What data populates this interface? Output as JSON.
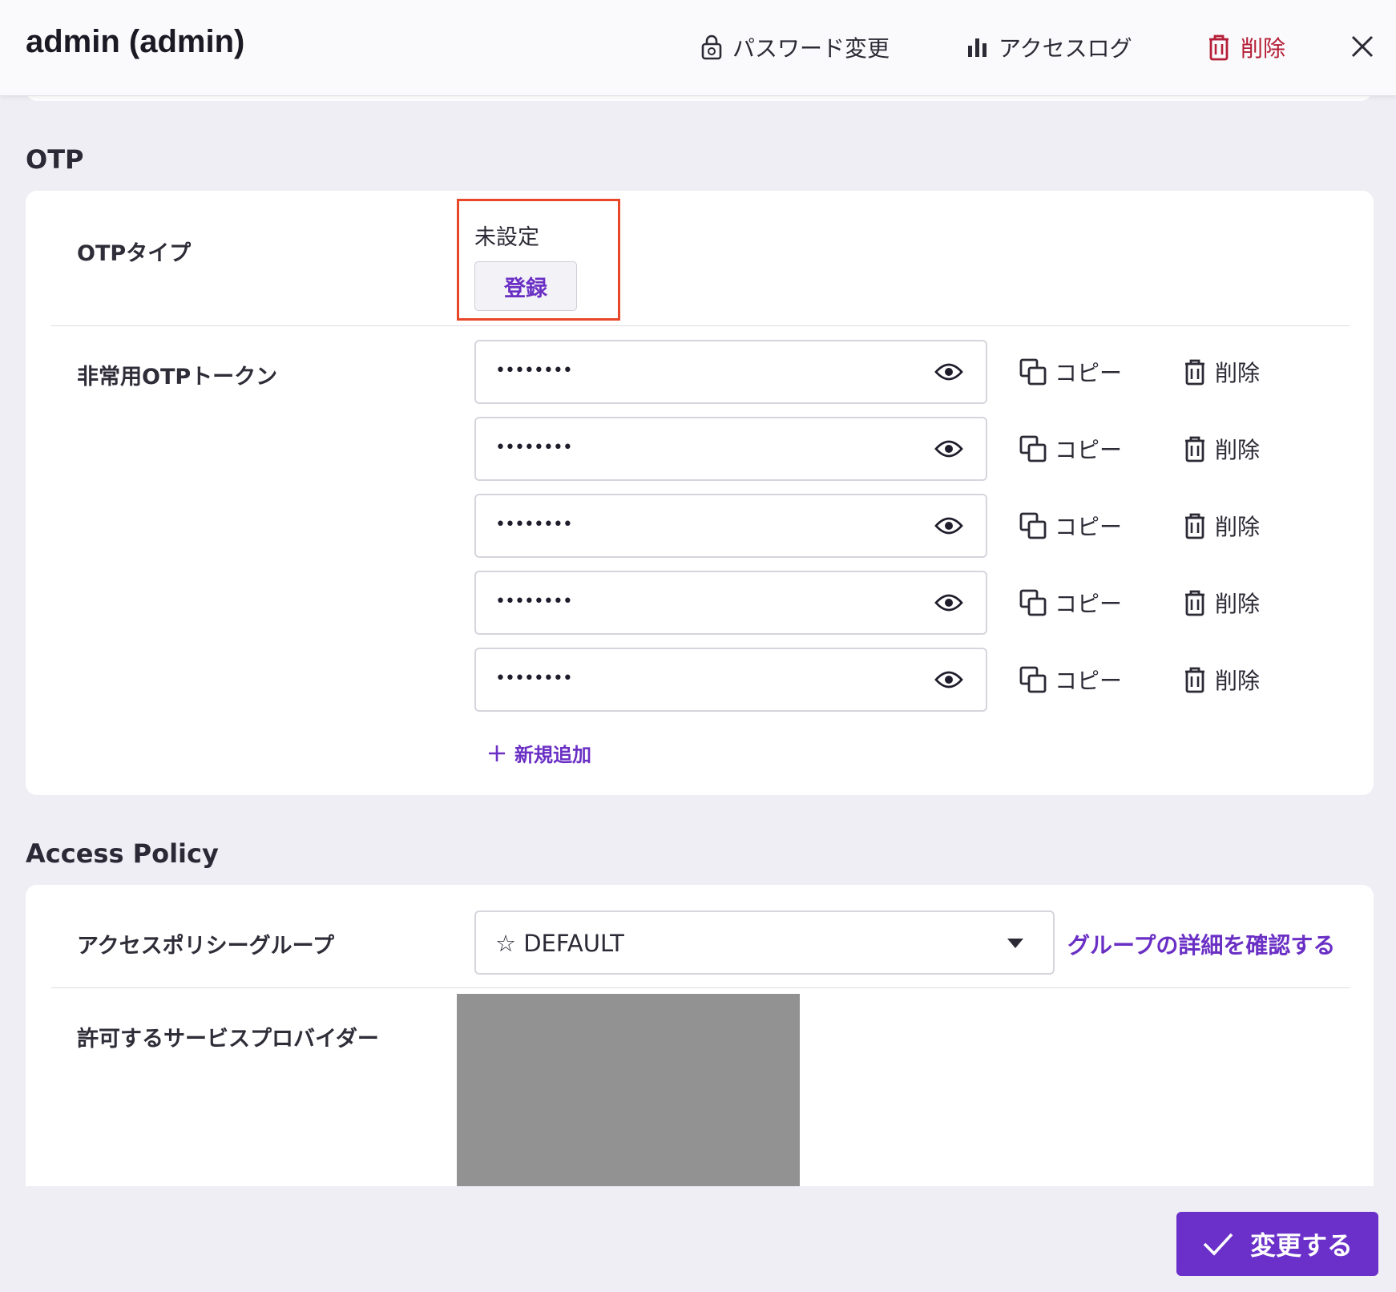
{
  "header": {
    "title": "admin (admin)",
    "change_password": "パスワード変更",
    "access_log": "アクセスログ",
    "delete": "削除",
    "icons": [
      "lock-icon",
      "bar-chart-icon",
      "trash-icon",
      "close-icon"
    ],
    "danger_color": "#b51f37"
  },
  "otp": {
    "section_title": "OTP",
    "type_label": "OTPタイプ",
    "type_value": "未設定",
    "register_button": "登録",
    "emergency_label": "非常用OTPトークン",
    "tokens": [
      {
        "value": "••••••••",
        "copy": "コピー",
        "delete": "削除"
      },
      {
        "value": "••••••••",
        "copy": "コピー",
        "delete": "削除"
      },
      {
        "value": "••••••••",
        "copy": "コピー",
        "delete": "削除"
      },
      {
        "value": "••••••••",
        "copy": "コピー",
        "delete": "削除"
      },
      {
        "value": "••••••••",
        "copy": "コピー",
        "delete": "削除"
      }
    ],
    "add_new": "新規追加"
  },
  "access_policy": {
    "section_title": "Access Policy",
    "group_label": "アクセスポリシーグループ",
    "group_value": "☆ DEFAULT",
    "group_link": "グループの詳細を確認する",
    "providers_label": "許可するサービスプロバイダー"
  },
  "footer": {
    "submit": "変更する"
  },
  "colors": {
    "accent": "#6a30c9",
    "highlight_border": "#e8472a",
    "background": "#efeef4"
  }
}
